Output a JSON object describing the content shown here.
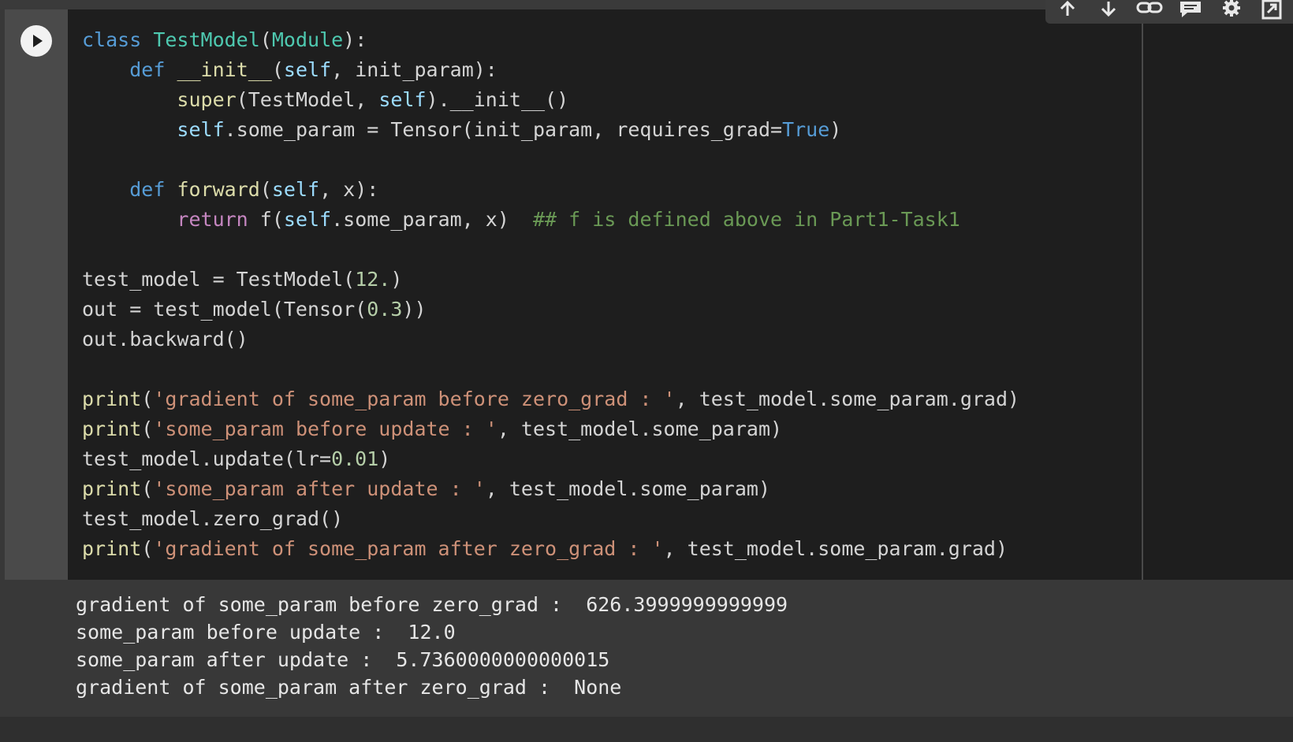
{
  "toolbar": {
    "icons": [
      "move-up-icon",
      "move-down-icon",
      "link-icon",
      "comment-icon",
      "settings-icon",
      "open-tab-icon"
    ]
  },
  "cell": {
    "code_lines": [
      "class TestModel(Module):",
      "    def __init__(self, init_param):",
      "        super(TestModel, self).__init__()",
      "        self.some_param = Tensor(init_param, requires_grad=True)",
      "",
      "    def forward(self, x):",
      "        return f(self.some_param, x)  ## f is defined above in Part1-Task1",
      "",
      "test_model = TestModel(12.)",
      "out = test_model(Tensor(0.3))",
      "out.backward()",
      "",
      "print('gradient of some_param before zero_grad : ', test_model.some_param.grad)",
      "print('some_param before update : ', test_model.some_param)",
      "test_model.update(lr=0.01)",
      "print('some_param after update : ', test_model.some_param)",
      "test_model.zero_grad()",
      "print('gradient of some_param after zero_grad : ', test_model.some_param.grad)"
    ],
    "output_lines": [
      "gradient of some_param before zero_grad :  626.3999999999999",
      "some_param before update :  12.0",
      "some_param after update :  5.7360000000000015",
      "gradient of some_param after zero_grad :  None"
    ]
  },
  "colors": {
    "keyword": "#569cd6",
    "class_name": "#4ec9b0",
    "function": "#dcdcaa",
    "string": "#ce9178",
    "number": "#b5cea8",
    "comment": "#6a9955",
    "control": "#c586c0",
    "background": "#1e1e1e",
    "output_background": "#383838"
  }
}
